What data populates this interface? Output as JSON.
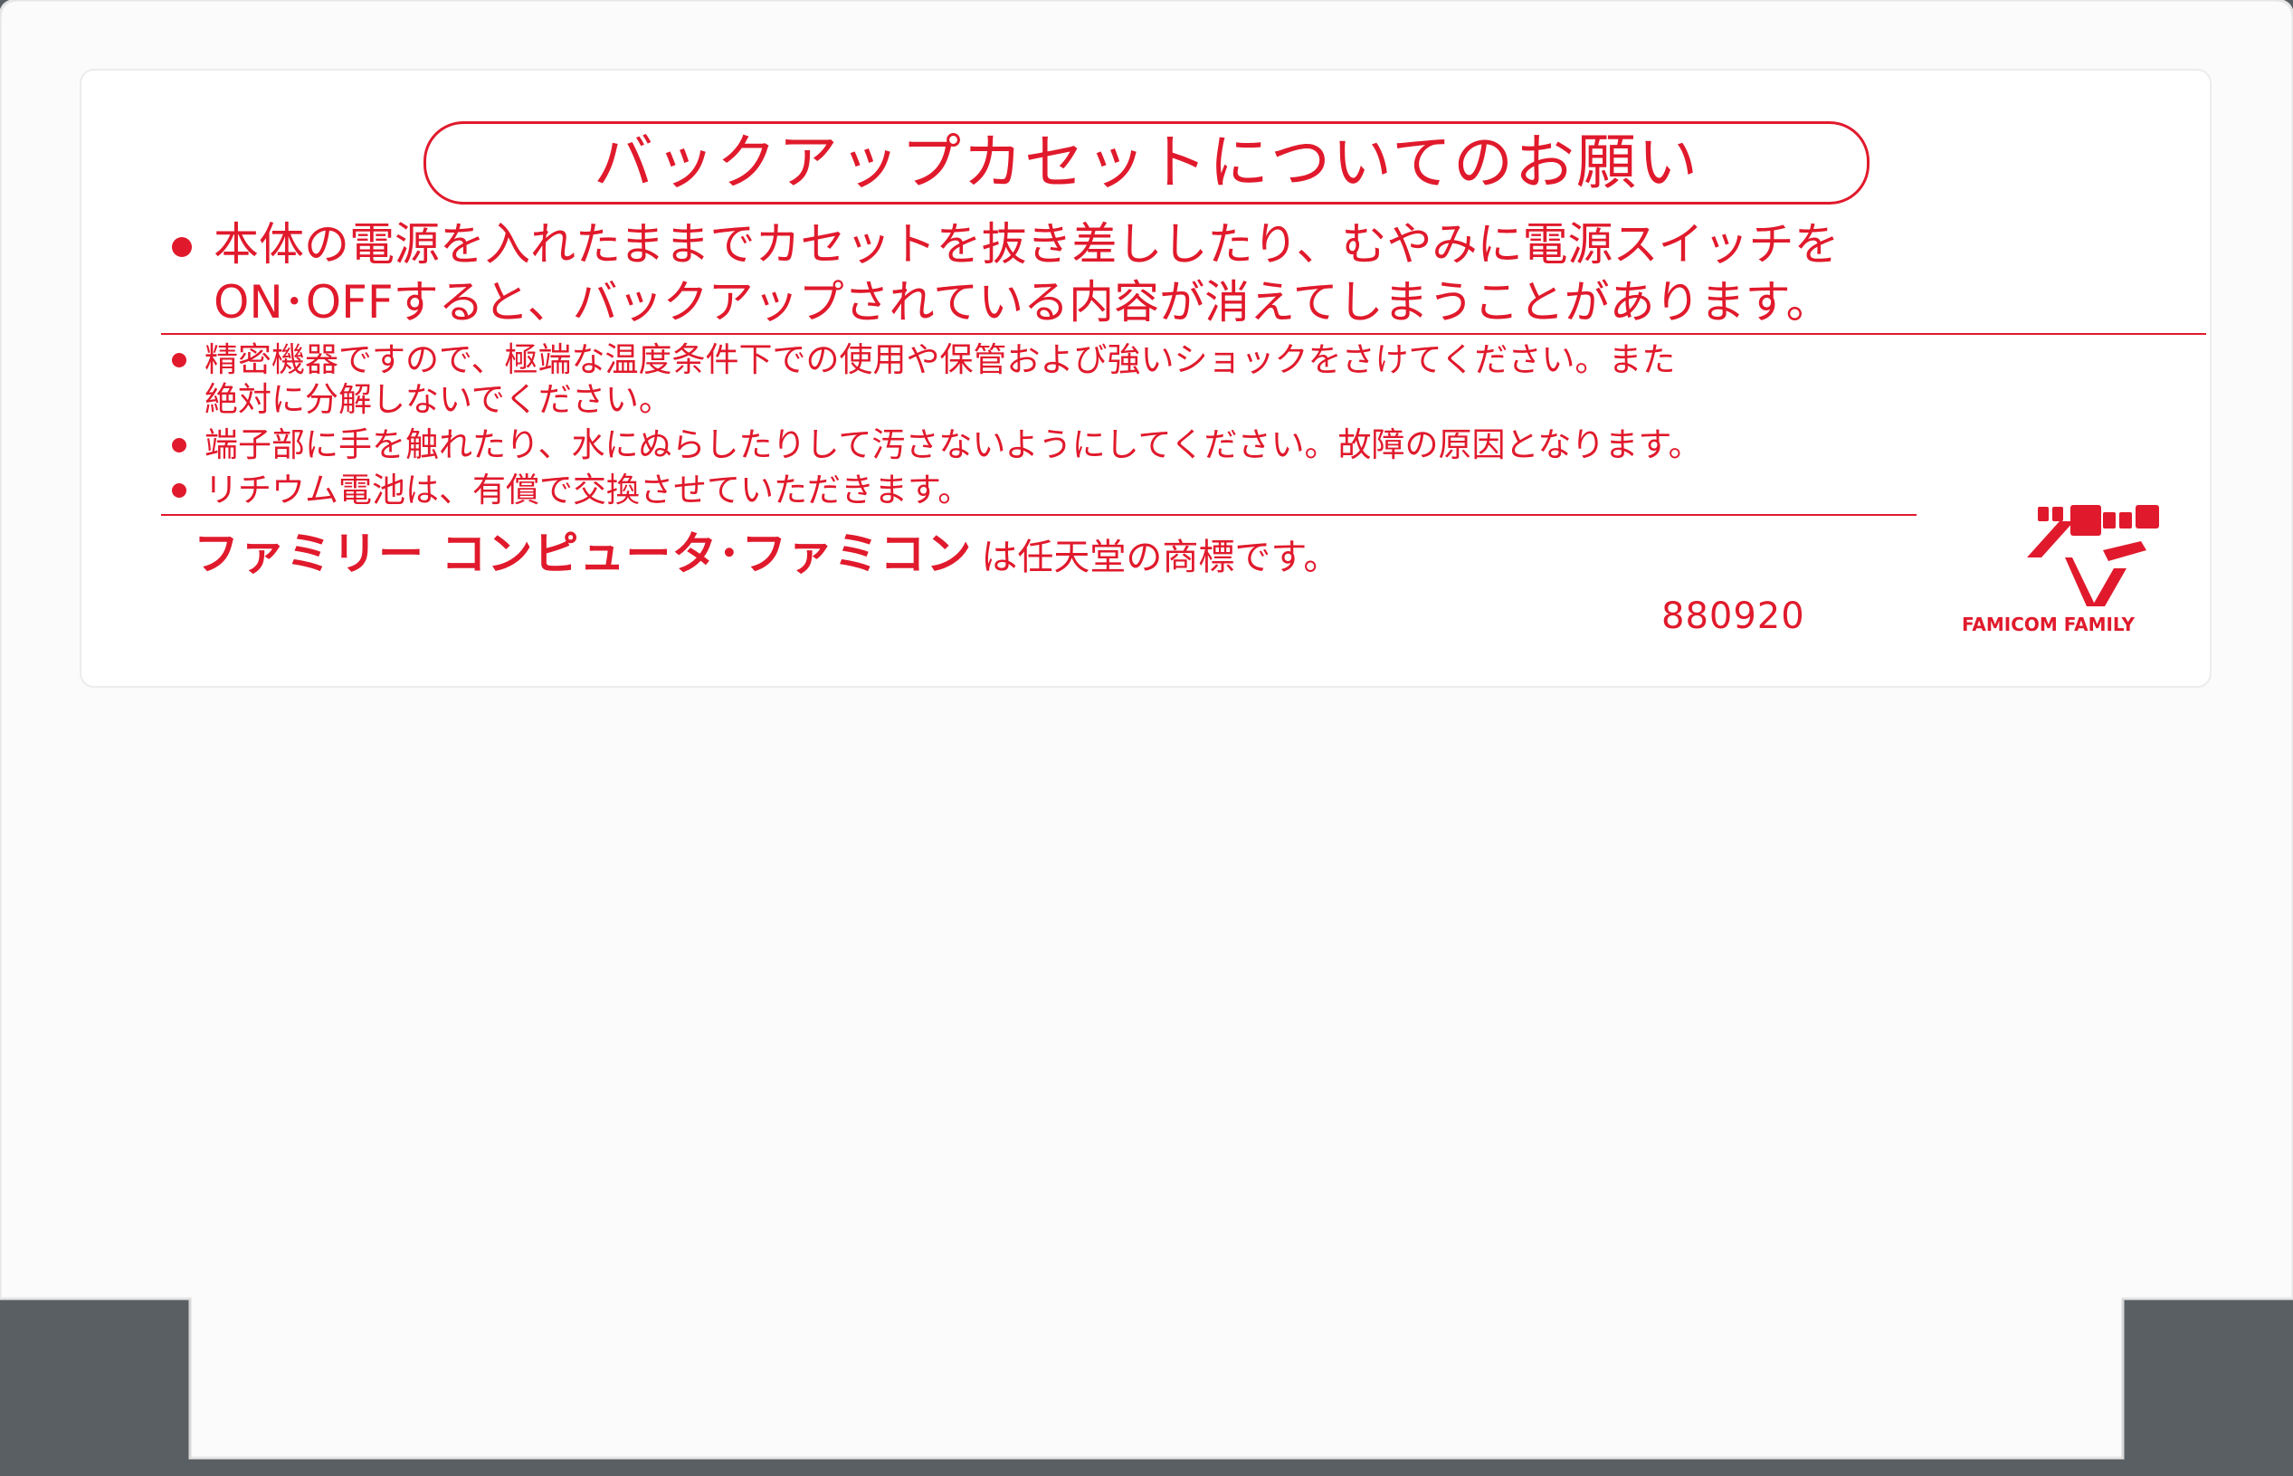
{
  "colors": {
    "shell": "#fbfbfb",
    "shell_edge": "#e6e6e6",
    "label_bg": "#ffffff",
    "accent_red": "#e01a2c",
    "background": "#5a5f63"
  },
  "label": {
    "title": "バックアップカセットについてのお願い",
    "main_warning": {
      "line1": "本体の電源を入れたままでカセットを抜き差ししたり、むやみに電源スイッチを",
      "line2": "ON･OFFすると、バックアップされている内容が消えてしまうことがあります。"
    },
    "notes": [
      {
        "line1": "精密機器ですので、極端な温度条件下での使用や保管および強いショックをさけてください。また",
        "line2": "絶対に分解しないでください。"
      },
      {
        "line1": "端子部に手を触れたり、水にぬらしたりして汚さないようにしてください。故障の原因となります。"
      },
      {
        "line1": "リチウム電池は、有償で交換させていただきます。"
      }
    ],
    "trademark": {
      "brand": "ファミリー コンピュータ･ファミコン",
      "rest": "は任天堂の商標です。"
    },
    "code": "880920",
    "logo": {
      "icon": "famicom-family-logo-icon",
      "caption": "FAMICOM FAMILY"
    }
  }
}
